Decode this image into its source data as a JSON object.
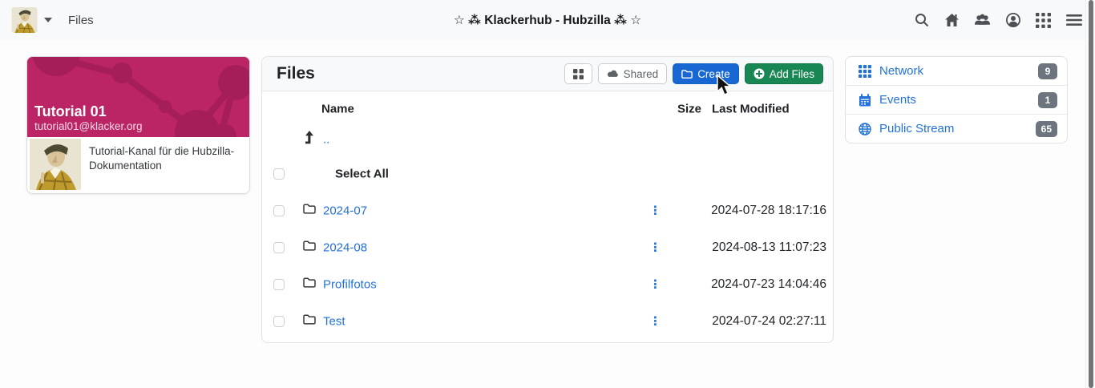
{
  "navbar": {
    "breadcrumb": "Files",
    "title": "☆ ⁂ Klackerhub - Hubzilla ⁂ ☆",
    "icons": [
      "search-icon",
      "home-icon",
      "groups-icon",
      "account-icon",
      "apps-grid-icon",
      "menu-icon"
    ]
  },
  "profile_card": {
    "channel_name": "Tutorial 01",
    "channel_address": "tutorial01@klacker.org",
    "description": "Tutorial-Kanal für die Hubzilla-Dokumentation"
  },
  "files_panel": {
    "title": "Files",
    "view_toggle_icon": "grid-2x2-icon",
    "shared_button": "Shared",
    "create_button": "Create",
    "add_files_button": "Add Files",
    "columns": {
      "name": "Name",
      "size": "Size",
      "modified": "Last Modified"
    },
    "parent_link": "..",
    "select_all": "Select All",
    "row_menu_glyph": "⋮",
    "rows": [
      {
        "name": "2024-07",
        "size": "",
        "modified": "2024-07-28 18:17:16"
      },
      {
        "name": "2024-08",
        "size": "",
        "modified": "2024-08-13 11:07:23"
      },
      {
        "name": "Profilfotos",
        "size": "",
        "modified": "2024-07-23 14:04:46"
      },
      {
        "name": "Test",
        "size": "",
        "modified": "2024-07-24 02:27:11"
      }
    ]
  },
  "right_sidebar": {
    "items": [
      {
        "label": "Network",
        "count": "9",
        "icon": "grid-3x3-icon"
      },
      {
        "label": "Events",
        "count": "1",
        "icon": "calendar-icon"
      },
      {
        "label": "Public Stream",
        "count": "65",
        "icon": "globe-icon"
      }
    ]
  },
  "colors": {
    "navbar_bg": "#f8f9fa",
    "banner": "#bb2565",
    "banner_pattern": "#a51e59",
    "primary_button": "#1967d2",
    "success_button": "#198754",
    "link": "#2372d8",
    "badge": "#6c757d"
  }
}
